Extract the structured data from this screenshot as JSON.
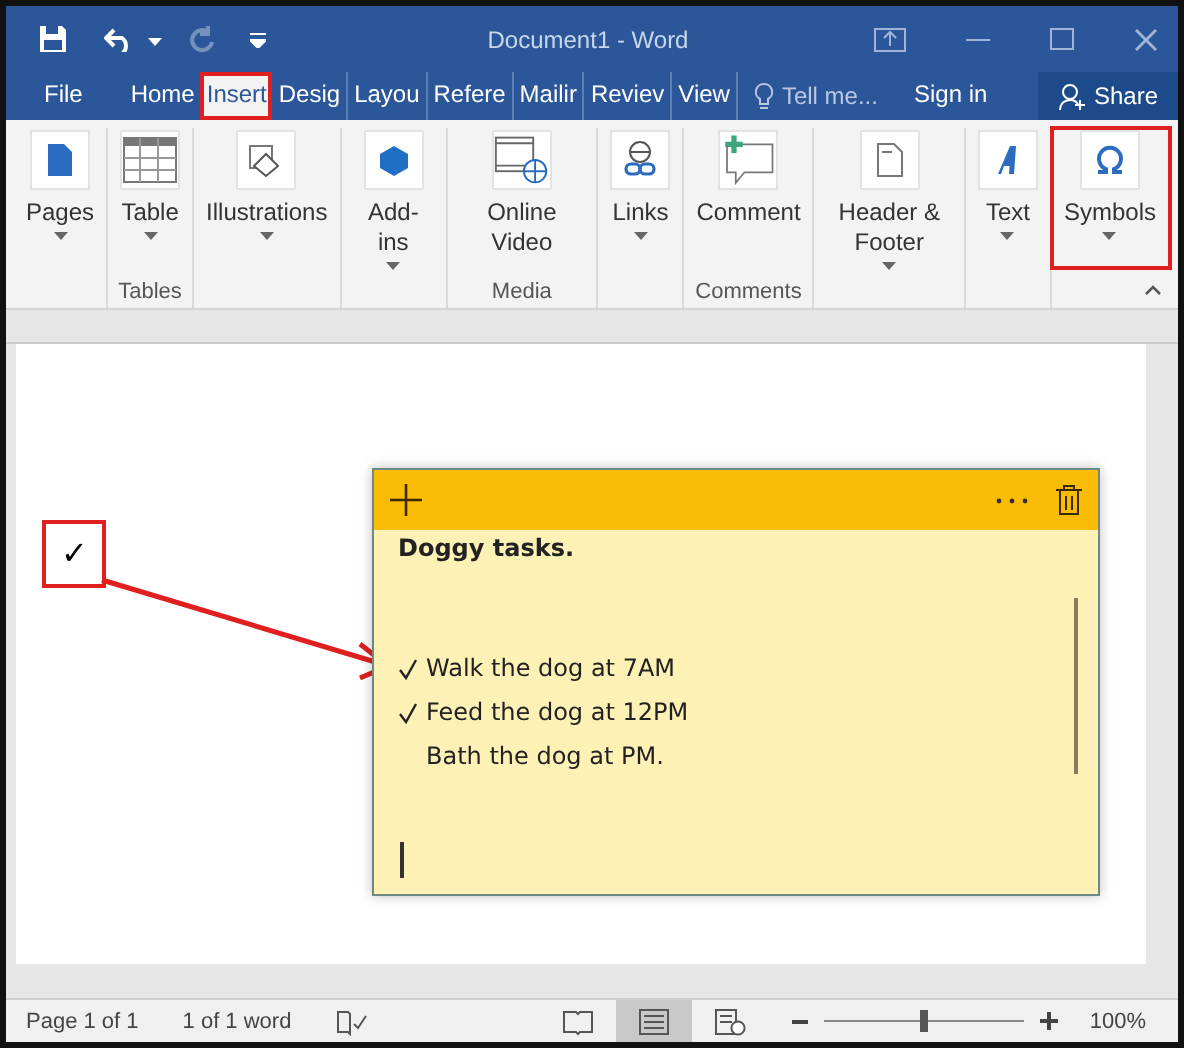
{
  "window": {
    "title": "Document1 - Word",
    "quick_access": {
      "redo_disabled": true
    }
  },
  "tabs": [
    {
      "label": "File",
      "selected": false
    },
    {
      "label": "Home",
      "selected": false
    },
    {
      "label": "Insert",
      "selected": true
    },
    {
      "label": "Desig",
      "selected": false
    },
    {
      "label": "Layou",
      "selected": false
    },
    {
      "label": "Refere",
      "selected": false
    },
    {
      "label": "Mailir",
      "selected": false
    },
    {
      "label": "Reviev",
      "selected": false
    },
    {
      "label": "View",
      "selected": false
    }
  ],
  "tell_me": {
    "placeholder": "Tell me..."
  },
  "sign_in": "Sign in",
  "share": "Share",
  "ribbon": [
    {
      "highlighted": false,
      "buttons": [
        {
          "kind": "pages",
          "label": "Pages",
          "dropdown": true
        }
      ]
    },
    {
      "label": "Tables",
      "highlighted": false,
      "buttons": [
        {
          "kind": "table",
          "label": "Table",
          "dropdown": true
        }
      ]
    },
    {
      "highlighted": false,
      "buttons": [
        {
          "kind": "shapes",
          "label": "Illustrations",
          "dropdown": true
        }
      ]
    },
    {
      "highlighted": false,
      "buttons": [
        {
          "kind": "addins",
          "label": "Add-ins",
          "dropdown": true
        }
      ]
    },
    {
      "label": "Media",
      "highlighted": false,
      "buttons": [
        {
          "kind": "video",
          "label": "Online Video",
          "dropdown": false
        }
      ]
    },
    {
      "highlighted": false,
      "buttons": [
        {
          "kind": "links",
          "label": "Links",
          "dropdown": true
        }
      ]
    },
    {
      "label": "Comments",
      "highlighted": false,
      "buttons": [
        {
          "kind": "comment",
          "label": "Comment",
          "dropdown": false
        }
      ]
    },
    {
      "highlighted": false,
      "buttons": [
        {
          "kind": "header",
          "label": "Header & Footer",
          "dropdown": true
        }
      ]
    },
    {
      "highlighted": false,
      "buttons": [
        {
          "kind": "text",
          "label": "Text",
          "dropdown": true
        }
      ]
    },
    {
      "highlighted": true,
      "buttons": [
        {
          "kind": "omega",
          "label": "Symbols",
          "dropdown": true
        }
      ]
    }
  ],
  "document": {
    "symbol": "✓",
    "symbol_highlighted": true
  },
  "sticky_note": {
    "title": "Doggy tasks.",
    "items": [
      {
        "text": "Walk the dog at 7AM",
        "checked": true
      },
      {
        "text": "Feed the dog at 12PM",
        "checked": true
      },
      {
        "text": "Bath the dog at PM.",
        "checked": false
      }
    ]
  },
  "status_bar": {
    "page": "Page 1 of 1",
    "words": "1 of 1 word",
    "views": [
      {
        "kind": "read",
        "selected": false
      },
      {
        "kind": "print",
        "selected": true
      },
      {
        "kind": "web",
        "selected": false
      }
    ],
    "zoom": {
      "level": 0.5,
      "reading": "100%"
    }
  }
}
